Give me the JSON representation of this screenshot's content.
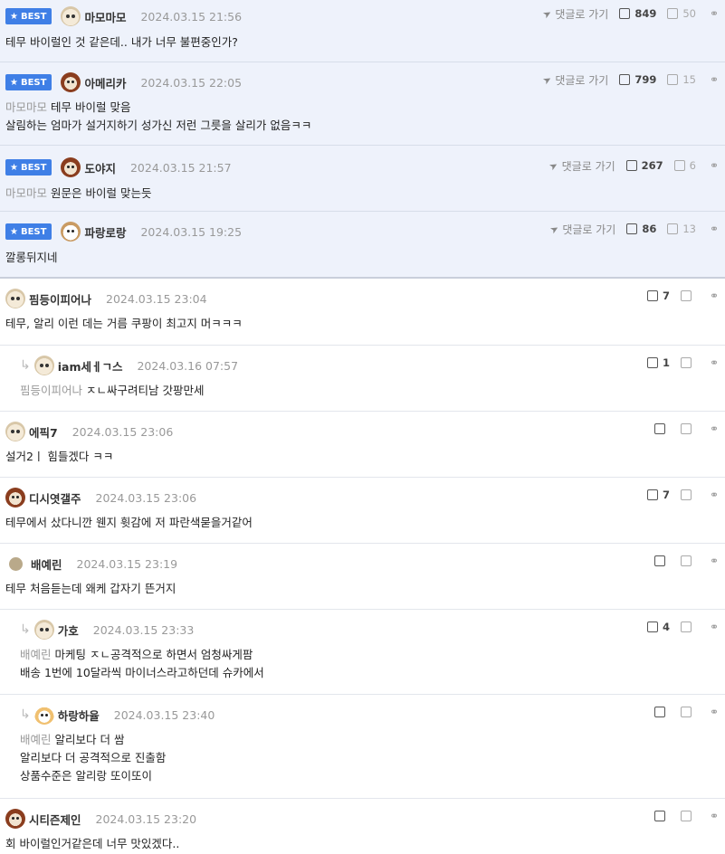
{
  "best_label": "BEST",
  "goto_label": "댓글로 가기",
  "comments": [
    {
      "nick": "마모마모",
      "date": "2024.03.15 21:56",
      "up": "849",
      "down": "50",
      "mention": "",
      "lines": [
        "테무 바이럴인 것 같은데.. 내가 너무 불편중인가?"
      ]
    },
    {
      "nick": "아메리카",
      "date": "2024.03.15 22:05",
      "up": "799",
      "down": "15",
      "mention": "마모마모",
      "lines": [
        "테무 바이럴 맞음",
        "살림하는 엄마가 설거지하기 성가신 저런 그릇을 살리가 없음ㅋㅋ"
      ]
    },
    {
      "nick": "도야지",
      "date": "2024.03.15 21:57",
      "up": "267",
      "down": "6",
      "mention": "마모마모",
      "lines": [
        "원문은 바이럴 맞는듯"
      ]
    },
    {
      "nick": "파랑로랑",
      "date": "2024.03.15 19:25",
      "up": "86",
      "down": "13",
      "mention": "",
      "lines": [
        "깔롱뒤지네"
      ]
    },
    {
      "nick": "핌등이피어나",
      "date": "2024.03.15 23:04",
      "up": "7",
      "down": "",
      "mention": "",
      "lines": [
        "테무, 알리 이런 데는 거름 쿠팡이 최고지 머ㅋㅋㅋ"
      ]
    },
    {
      "nick": "iam세ㅔㄱ스",
      "date": "2024.03.16 07:57",
      "up": "1",
      "down": "",
      "mention": "핌등이피어나",
      "lines": [
        "ㅈㄴ싸구려티남 갓팡만세"
      ]
    },
    {
      "nick": "에픽7",
      "date": "2024.03.15 23:06",
      "up": "",
      "down": "",
      "mention": "",
      "lines": [
        "설거2ㅣ  힘들겠다 ㅋㅋ"
      ]
    },
    {
      "nick": "디시엿갤주",
      "date": "2024.03.15 23:06",
      "up": "7",
      "down": "",
      "mention": "",
      "lines": [
        "테무에서 샀다니깐 웬지 휫감에 저 파란색묻을거같어"
      ]
    },
    {
      "nick": "배예린",
      "date": "2024.03.15 23:19",
      "up": "",
      "down": "",
      "mention": "",
      "lines": [
        "테무 처음듣는데 왜케 갑자기 뜬거지"
      ]
    },
    {
      "nick": "가호",
      "date": "2024.03.15 23:33",
      "up": "4",
      "down": "",
      "mention": "배예린",
      "lines": [
        "마케팅 ㅈㄴ공격적으로 하면서 엄청싸게팜",
        "배송 1번에 10달라씩 마이너스라고하던데 슈카에서"
      ]
    },
    {
      "nick": "하랑하율",
      "date": "2024.03.15 23:40",
      "up": "",
      "down": "",
      "mention": "배예린",
      "lines": [
        "알리보다 더 쌈",
        "알리보다 더 공격적으로 진출함",
        "상품수준은 알리랑 또이또이"
      ]
    },
    {
      "nick": "시티즌제인",
      "date": "2024.03.15 23:20",
      "up": "",
      "down": "",
      "mention": "",
      "lines": [
        "회 바이럴인거같은데 너무 맛있겠다.."
      ]
    }
  ]
}
